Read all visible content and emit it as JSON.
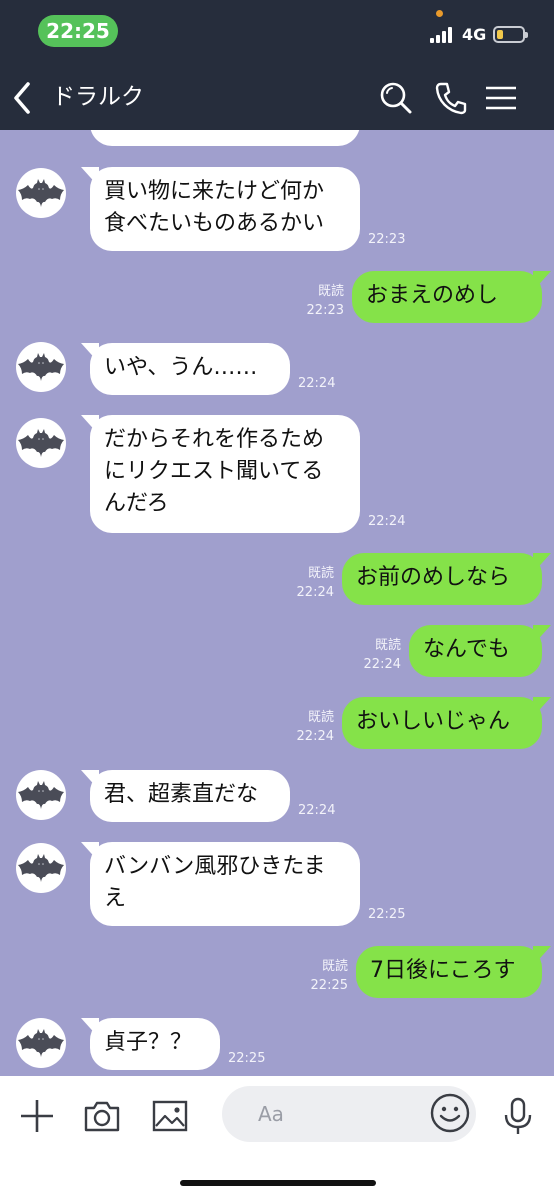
{
  "status_bar": {
    "time": "22:25",
    "network": "4G",
    "battery_level": 0.25
  },
  "header": {
    "title": "ドラルク",
    "icons": [
      "back-icon",
      "search-icon",
      "phone-icon",
      "menu-icon"
    ]
  },
  "messages": [
    {
      "side": "in",
      "lines": [
        "買い物に来たけど何か",
        "食べたいものあるかい"
      ],
      "time": "22:23"
    },
    {
      "side": "out",
      "lines": [
        "おまえのめし"
      ],
      "read": "既読",
      "time": "22:23"
    },
    {
      "side": "in",
      "lines": [
        "いや、うん……"
      ],
      "time": "22:24"
    },
    {
      "side": "in",
      "lines": [
        "だからそれを作るため",
        "にリクエスト聞いてる",
        "んだろ"
      ],
      "time": "22:24"
    },
    {
      "side": "out",
      "lines": [
        "お前のめしなら"
      ],
      "read": "既読",
      "time": "22:24"
    },
    {
      "side": "out",
      "lines": [
        "なんでも"
      ],
      "read": "既読",
      "time": "22:24"
    },
    {
      "side": "out",
      "lines": [
        "おいしいじゃん"
      ],
      "read": "既読",
      "time": "22:24"
    },
    {
      "side": "in",
      "lines": [
        "君、超素直だな"
      ],
      "time": "22:24"
    },
    {
      "side": "in",
      "lines": [
        "バンバン風邪ひきたま",
        "え"
      ],
      "time": "22:25"
    },
    {
      "side": "out",
      "lines": [
        "7日後にころす"
      ],
      "read": "既読",
      "time": "22:25"
    },
    {
      "side": "in",
      "lines": [
        "貞子？？"
      ],
      "time": "22:25"
    }
  ],
  "input_bar": {
    "placeholder": "Aa",
    "icons": [
      "plus-icon",
      "camera-icon",
      "image-icon",
      "emoji-icon",
      "microphone-icon"
    ]
  },
  "colors": {
    "header_bg": "#262d3c",
    "chat_bg": "#a09fcd",
    "sent_bubble": "#85e249",
    "received_bubble": "#ffffff",
    "status_time_pill": "#55c25a"
  }
}
